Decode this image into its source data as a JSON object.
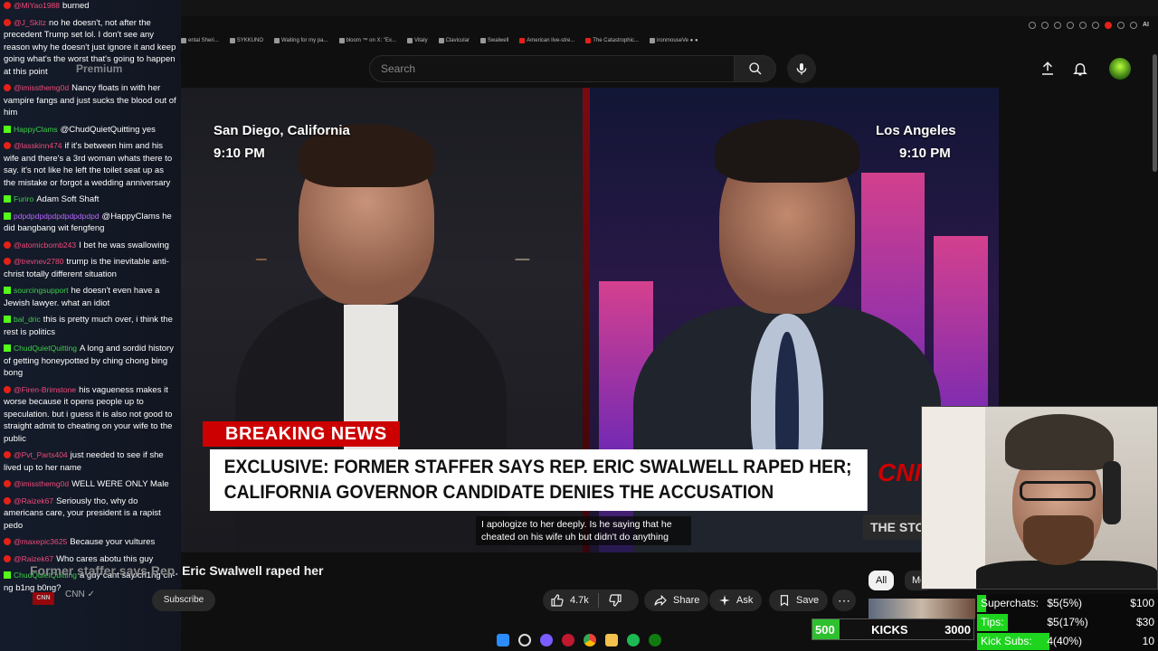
{
  "bookmarks": [
    {
      "label": "ental Sheri..."
    },
    {
      "label": "SYKKUNO"
    },
    {
      "label": "Waiting for my pa..."
    },
    {
      "label": "bloom ™ on X: \"Ex..."
    },
    {
      "label": "Vitaly"
    },
    {
      "label": "Clavicular"
    },
    {
      "label": "Swalwell"
    },
    {
      "label": "American live-stre..."
    },
    {
      "label": "The Catastrophic..."
    },
    {
      "label": "ironmouseVe ● ●"
    }
  ],
  "ext_label": "AI",
  "search": {
    "placeholder": "Search"
  },
  "premium_watermark": "Premium",
  "video": {
    "left_location": "San Diego, California",
    "left_time": "9:10 PM",
    "right_location": "Los Angeles",
    "right_time": "9:10 PM",
    "breaking": "BREAKING NEWS",
    "chyron_line1": "EXCLUSIVE: FORMER STAFFER SAYS REP. ERIC SWALWELL RAPED HER;",
    "chyron_line2": "CALIFORNIA GOVERNOR CANDIDATE DENIES THE ACCUSATION",
    "cnn_logo": "CNN",
    "the_story": "THE STO",
    "caption_line1": "I apologize to her deeply. Is he saying that he",
    "caption_line2": "cheated on his wife uh but didn't do anything"
  },
  "chat": [
    {
      "platform": "yt",
      "user": "@MiYao1988",
      "text": "burned"
    },
    {
      "platform": "yt",
      "user": "@J_Skitz",
      "text": "no he doesn't, not after the precedent Trump set lol. I don't see any reason why he doesn't just ignore it and keep going what's the worst that's going to happen at this point"
    },
    {
      "platform": "yt",
      "user": "@imissthemg0d",
      "text": "Nancy floats in with her vampire fangs and just sucks the blood out of him"
    },
    {
      "platform": "kick",
      "user": "HappyClams",
      "text": "@ChudQuietQuitting yes"
    },
    {
      "platform": "yt",
      "user": "@lasskinn474",
      "text": "if it's between him and his wife and there's a 3rd woman whats there to say. it's not like he left the toilet seat up as the mistake or forgot a wedding anniversary"
    },
    {
      "platform": "kick",
      "user": "Furiro",
      "text": "Adam Soft Shaft"
    },
    {
      "platform": "kick",
      "user": "pdpdpdpdpdpdpdpdpdpd",
      "text": "@HappyClams he did bangbang wit fengfeng"
    },
    {
      "platform": "yt",
      "user": "@atomicbomb243",
      "text": "I bet he was swallowing"
    },
    {
      "platform": "yt",
      "user": "@trevnev2780",
      "text": "trump is the inevitable anti-christ totally different situation"
    },
    {
      "platform": "kick",
      "user": "sourcingsupport",
      "text": "he doesn't even have a Jewish lawyer. what an idiot"
    },
    {
      "platform": "kick",
      "user": "bal_dric",
      "text": "this is pretty much over, i think the rest is politics"
    },
    {
      "platform": "kick",
      "user": "ChudQuietQuitting",
      "text": "A long and sordid history of getting honeypotted by ching chong bing bong"
    },
    {
      "platform": "yt",
      "user": "@Firen-Brimstone",
      "text": "his vagueness makes it worse because it opens people up to speculation. but i guess it is also not good to straight admit to cheating on your wife to the public"
    },
    {
      "platform": "yt",
      "user": "@Pvt_Parts404",
      "text": "just needed to see if she lived up to her name"
    },
    {
      "platform": "yt",
      "user": "@imissthemg0d",
      "text": "WELL WERE ONLY Male"
    },
    {
      "platform": "yt",
      "user": "@Raizek67",
      "text": "Seriously tho, why do americans care, your president is a rapist pedo"
    },
    {
      "platform": "yt",
      "user": "@maxepic3625",
      "text": "Because your vultures"
    },
    {
      "platform": "yt",
      "user": "@Raizek67",
      "text": "Who cares abotu this guy"
    },
    {
      "platform": "kick",
      "user": "ChudQuietQuitting",
      "text": "a guy cant say ch1ng ch-ng b1ng b0ng?"
    }
  ],
  "title": {
    "faded": "Former staffer says Rep.",
    "main": "Eric Swalwell raped her"
  },
  "channel": {
    "tag": "CNN",
    "name": "CNN ✓",
    "subscribe": "Subscribe"
  },
  "actions": {
    "likes": "4.7k",
    "share": "Share",
    "ask": "Ask",
    "save": "Save"
  },
  "chips": {
    "all": "All",
    "more": "Mo"
  },
  "kicks": {
    "left": "500",
    "label": "KICKS",
    "right": "3000",
    "progress": 0.17
  },
  "donations": [
    {
      "label": "Superchats:",
      "value": "$5(5%)",
      "goal": "$100",
      "progress": 0.05,
      "color": "#1ed41e"
    },
    {
      "label": "Tips:",
      "value": "$5(17%)",
      "goal": "$30",
      "progress": 0.17,
      "color": "#1ed41e"
    },
    {
      "label": "Kick Subs:",
      "value": "4(40%)",
      "goal": "10",
      "progress": 0.4,
      "color": "#1ed41e"
    }
  ]
}
